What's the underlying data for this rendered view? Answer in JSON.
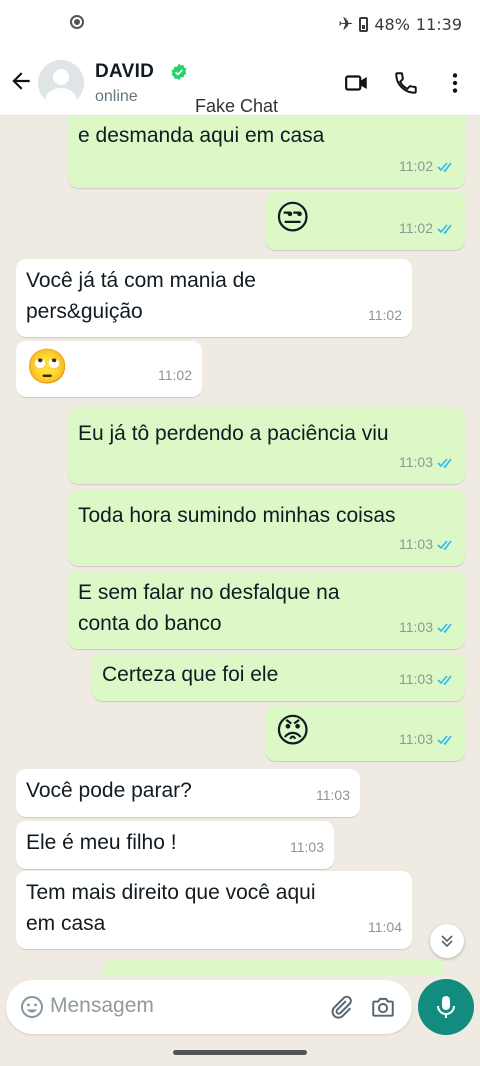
{
  "status_bar": {
    "time": "11:39",
    "battery": "48%"
  },
  "header": {
    "contact_name": "DAVID",
    "status": "online",
    "watermark": "Fake Chat"
  },
  "messages": [
    {
      "side": "out",
      "text": "e desmanda aqui em casa",
      "time": "11:02",
      "read": true
    },
    {
      "side": "out",
      "text": "😒",
      "time": "11:02",
      "read": true,
      "emoji": true
    },
    {
      "side": "in",
      "text": "Você já tá com mania de\npers&guição",
      "time": "11:02"
    },
    {
      "side": "in",
      "text": "🙄",
      "time": "11:02",
      "emoji": true
    },
    {
      "side": "out",
      "text": "Eu já tô perdendo a paciência viu",
      "time": "11:03",
      "read": true
    },
    {
      "side": "out",
      "text": "Toda hora sumindo minhas coisas",
      "time": "11:03",
      "read": true
    },
    {
      "side": "out",
      "text": "E sem falar no desfalque na\nconta do banco",
      "time": "11:03",
      "read": true
    },
    {
      "side": "out",
      "text": "Certeza que foi ele",
      "time": "11:03",
      "read": true
    },
    {
      "side": "out",
      "text": "😡",
      "time": "11:03",
      "read": true,
      "emoji": true
    },
    {
      "side": "in",
      "text": "Você pode parar?",
      "time": "11:03"
    },
    {
      "side": "in",
      "text": "Ele é meu filho !",
      "time": "11:03"
    },
    {
      "side": "in",
      "text": "Tem mais direito que você aqui\nem casa",
      "time": "11:04"
    }
  ],
  "composer": {
    "placeholder": "Mensagem"
  },
  "colors": {
    "outgoing": "#dcf8c6",
    "incoming": "#ffffff",
    "accent": "#128c7e",
    "read_tick": "#34b7f1"
  },
  "icons": [
    "back-arrow-icon",
    "verified-badge-icon",
    "video-call-icon",
    "phone-icon",
    "more-options-icon",
    "emoji-icon",
    "attach-icon",
    "camera-icon",
    "mic-icon",
    "scroll-down-icon"
  ]
}
